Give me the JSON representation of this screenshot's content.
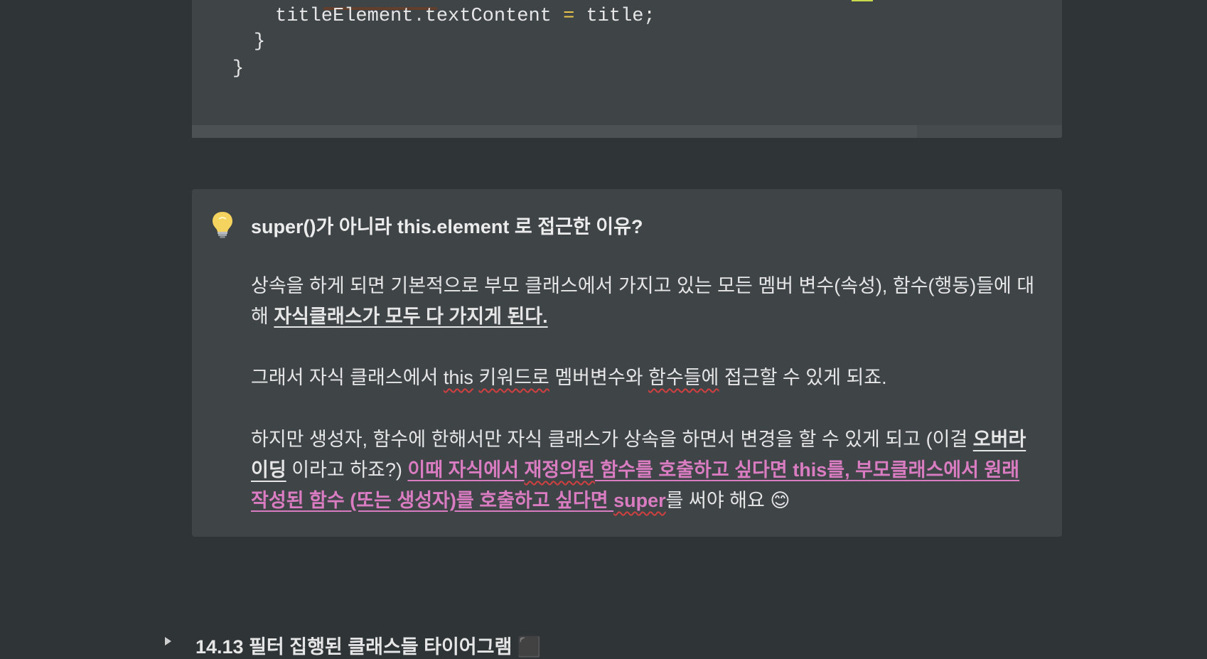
{
  "code": {
    "line1": {
      "obj": "titleElement",
      "dot": ".",
      "prop": "textContent",
      "op": "=",
      "value": "title;"
    },
    "line2": "}",
    "line3": "}"
  },
  "callout": {
    "icon": "lightbulb-icon",
    "title": "super()가 아니라 this.element 로 접근한 이유?",
    "p1": {
      "a": "상속을 하게 되면 기본적으로 부모 클래스에서 가지고 있는 모든 멤버 변수(속성), 함수(행동)들에 대해 ",
      "b": "자식클래스가 모두 다 가지게 된다."
    },
    "p2": {
      "a": "그래서 자식 클래스에서 ",
      "b": "this",
      "c": " ",
      "d": "키워드로",
      "e": " 멤버변수와 ",
      "f": "함수들에",
      "g": " 접근할 수 있게 되죠."
    },
    "p3": {
      "a": "하지만 생성자, 함수에 한해서만 자식 클래스가 상속을 하면서 변경을 할 수 있게 되고 (이걸 ",
      "b": "오버라이딩",
      "c": " 이라고 하죠?) ",
      "d": "이때 자식에서 ",
      "e": "재정의된",
      "f": " 함수를 호출하고 싶다면 this를, 부모클래스에서 원래 작성된 함수 (또는 생성자)를 호출하고 싶다면 ",
      "g": "super",
      "h": "를 써야 해요 😊"
    }
  },
  "next_section": {
    "title": "14.13 필터 집행된 클래스들 타이어그램 ⬛"
  },
  "colors": {
    "background": "#2f3437",
    "block": "#3f4447",
    "pink": "#d97cc1",
    "operator": "#e8c44a"
  }
}
